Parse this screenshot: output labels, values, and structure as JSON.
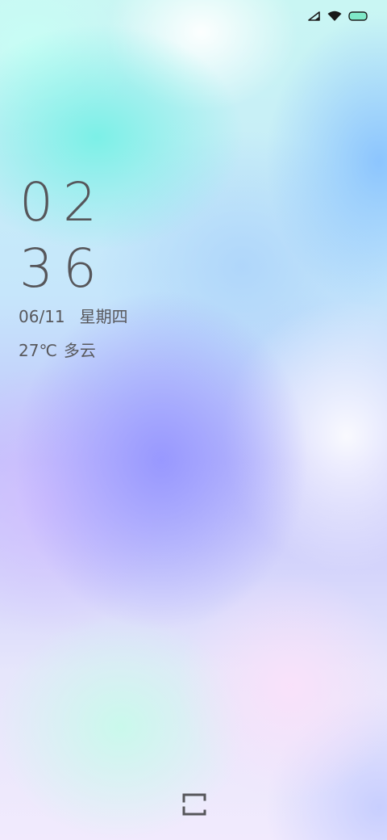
{
  "status_bar": {
    "icons": [
      "signal-icon",
      "wifi-icon",
      "battery-icon"
    ],
    "battery_color": "#7fe8c8"
  },
  "lock_screen": {
    "hour": "02",
    "minute": "36",
    "date": "06/11",
    "weekday": "星期四",
    "temperature": "27℃",
    "weather": "多云",
    "text_color": "#58585c"
  },
  "bottom": {
    "icon": "shortcut-icon"
  }
}
